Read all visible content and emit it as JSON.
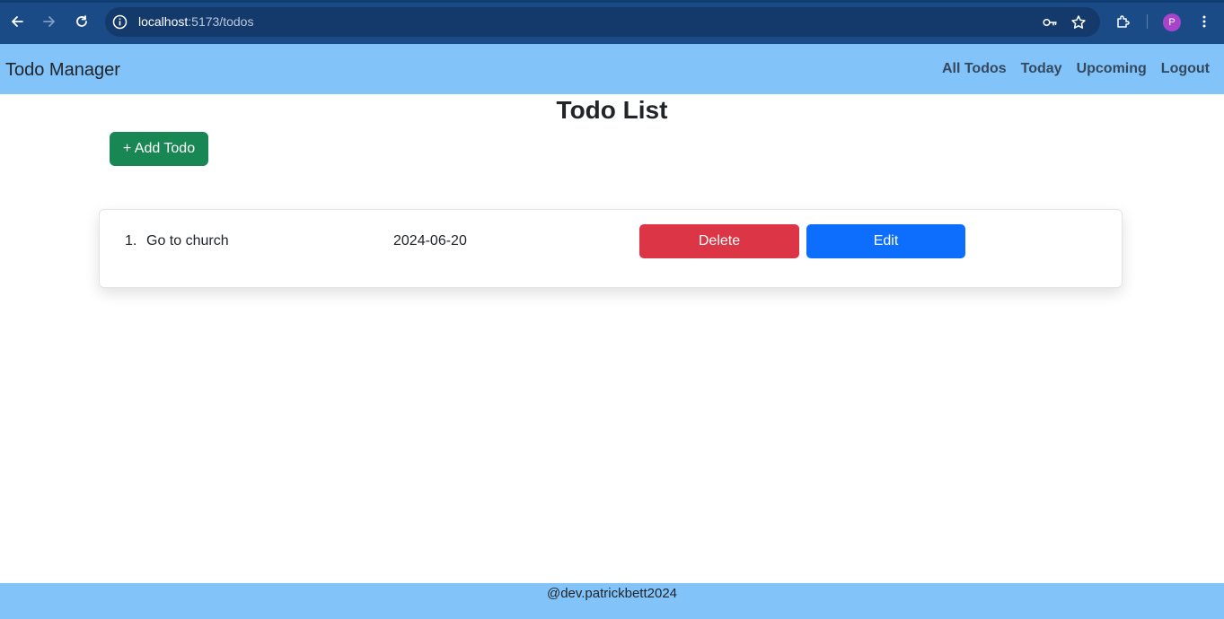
{
  "browser": {
    "url_host": "localhost",
    "url_path": ":5173/todos",
    "profile_initial": "P",
    "icons": [
      "back-arrow-icon",
      "forward-arrow-icon",
      "reload-icon",
      "site-info-icon",
      "password-key-icon",
      "bookmark-star-icon",
      "extensions-puzzle-icon",
      "more-vert-icon"
    ],
    "colors": {
      "chrome": "#1b4b86",
      "omnibox": "#143a6b",
      "profile": "#a844c9"
    }
  },
  "navbar": {
    "brand": "Todo Manager",
    "links": [
      "All Todos",
      "Today",
      "Upcoming",
      "Logout"
    ],
    "color": "#82c3f9"
  },
  "main": {
    "title": "Todo List",
    "add_button": "+ Add Todo",
    "todos": [
      {
        "number": "1.",
        "text": "Go to church",
        "date": "2024-06-20",
        "delete_label": "Delete",
        "edit_label": "Edit"
      }
    ],
    "colors": {
      "add": "#198754",
      "delete": "#dc3545",
      "edit": "#0d6efd"
    }
  },
  "footer": {
    "text": "@dev.patrickbett2024"
  }
}
